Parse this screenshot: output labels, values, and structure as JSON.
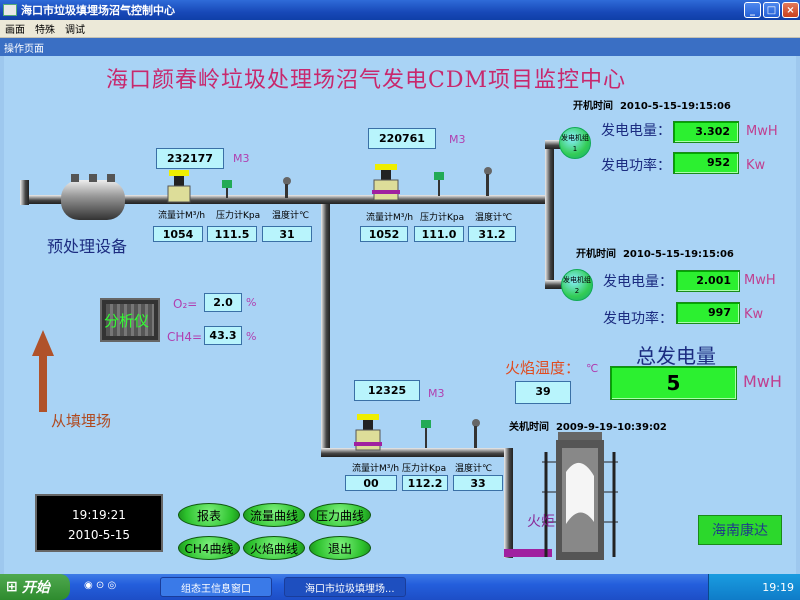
{
  "window": {
    "title": "海口市垃圾填埋场沼气控制中心",
    "menu": [
      "画面",
      "特殊",
      "调试"
    ],
    "min": "_",
    "max": "□",
    "close": "×"
  },
  "panel_title": "操作页面",
  "main_title": "海口颜春岭垃圾处理场沼气发电CDM项目监控中心",
  "pretreat": "预处理设备",
  "from_landfill": "从填埋场",
  "analyzer": {
    "label": "分析仪",
    "o2_label": "O₂=",
    "o2_value": "2.0",
    "o2_unit": "%",
    "ch4_label": "CH4=",
    "ch4_value": "43.3",
    "ch4_unit": "%"
  },
  "m3": "M3",
  "line1": {
    "total": "232177",
    "flow_label": "流量计M³/h",
    "pressure_label": "压力计Kpa",
    "temp_label": "温度计℃",
    "flow": "1054",
    "pressure": "111.5",
    "temp": "31"
  },
  "line2": {
    "total": "220761",
    "flow_label": "流量计M³/h",
    "pressure_label": "压力计Kpa",
    "temp_label": "温度计℃",
    "flow": "1052",
    "pressure": "111.0",
    "temp": "31.2"
  },
  "line3": {
    "total": "12325",
    "flow_label": "流量计M³/h",
    "pressure_label": "压力计Kpa",
    "temp_label": "温度计℃",
    "flow": "00",
    "pressure": "112.2",
    "temp": "33"
  },
  "gen1": {
    "label": "发电机组1",
    "start_label": "开机时间",
    "start_time": "2010-5-15-19:15:06",
    "energy_label": "发电电量：",
    "energy": "3.302",
    "energy_unit": "MwH",
    "power_label": "发电功率：",
    "power": "952",
    "power_unit": "Kw"
  },
  "gen2": {
    "label": "发电机组2",
    "start_label": "开机时间",
    "start_time": "2010-5-15-19:15:06",
    "energy_label": "发电电量：",
    "energy": "2.001",
    "energy_unit": "MwH",
    "power_label": "发电功率：",
    "power": "997",
    "power_unit": "Kw"
  },
  "total": {
    "label": "总发电量",
    "value": "5",
    "unit": "MwH"
  },
  "flare": {
    "temp_label": "火焰温度：",
    "temp_unit": "℃",
    "temp": "39",
    "stop_label": "关机时间",
    "stop_time": "2009-9-19-10:39:02",
    "label": "火炬"
  },
  "clock": {
    "time": "19:19:21",
    "date": "2010-5-15"
  },
  "buttons": {
    "report": "报表",
    "flow_curve": "流量曲线",
    "pressure_curve": "压力曲线",
    "ch4_curve": "CH4曲线",
    "flame_curve": "火焰曲线",
    "exit": "退出"
  },
  "brand": "海南康达",
  "taskbar": {
    "start": "开始",
    "task1": "组态王信息窗口",
    "task2": "海口市垃圾填埋场...",
    "time": "19:19"
  }
}
